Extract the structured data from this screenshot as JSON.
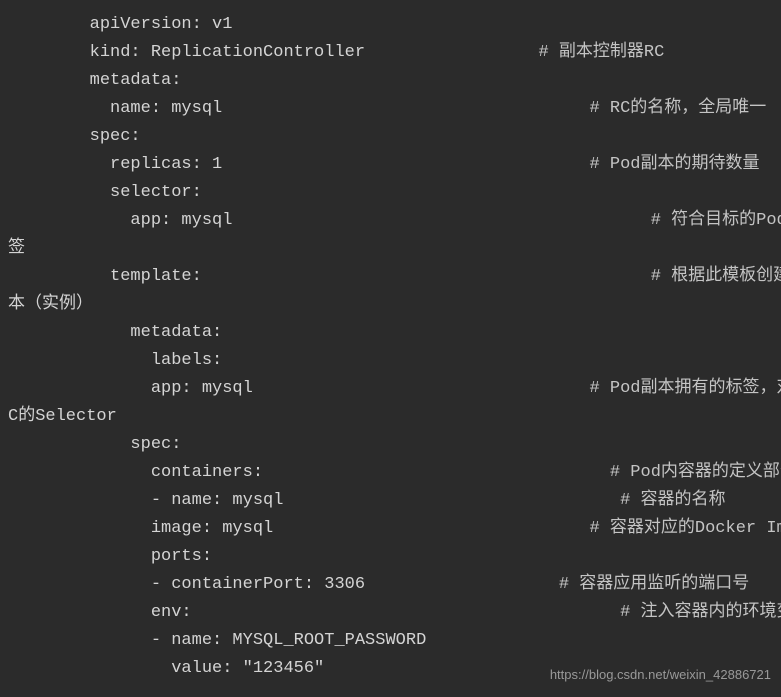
{
  "lines": [
    {
      "code": "        apiVersion: v1",
      "comment": ""
    },
    {
      "code": "        kind: ReplicationController                 ",
      "comment": "# 副本控制器RC"
    },
    {
      "code": "        metadata:",
      "comment": ""
    },
    {
      "code": "          name: mysql                                    ",
      "comment": "# RC的名称，全局唯一"
    },
    {
      "code": "        spec:",
      "comment": ""
    },
    {
      "code": "          replicas: 1                                    ",
      "comment": "# Pod副本的期待数量"
    },
    {
      "code": "          selector:",
      "comment": ""
    },
    {
      "code": "            app: mysql                                         ",
      "comment": "# 符合目标的Pod拥有此标"
    },
    {
      "code": "签",
      "comment": ""
    },
    {
      "code": "          template:                                            ",
      "comment": "# 根据此模板创建Pod的副"
    },
    {
      "code": "本（实例）",
      "comment": ""
    },
    {
      "code": "            metadata:",
      "comment": ""
    },
    {
      "code": "              labels:",
      "comment": ""
    },
    {
      "code": "              app: mysql                                 ",
      "comment": "# Pod副本拥有的标签，对应R"
    },
    {
      "code": "C的Selector",
      "comment": ""
    },
    {
      "code": "            spec:",
      "comment": ""
    },
    {
      "code": "              containers:                                  ",
      "comment": "# Pod内容器的定义部分"
    },
    {
      "code": "              - name: mysql                                 ",
      "comment": "# 容器的名称"
    },
    {
      "code": "              image: mysql                               ",
      "comment": "# 容器对应的Docker Image"
    },
    {
      "code": "              ports:",
      "comment": ""
    },
    {
      "code": "              - containerPort: 3306                   ",
      "comment": "# 容器应用监听的端口号"
    },
    {
      "code": "              env:                                          ",
      "comment": "# 注入容器内的环境变量"
    },
    {
      "code": "              - name: MYSQL_ROOT_PASSWORD",
      "comment": ""
    },
    {
      "code": "                value: \"123456\"",
      "comment": ""
    }
  ],
  "watermark": "https://blog.csdn.net/weixin_42886721"
}
